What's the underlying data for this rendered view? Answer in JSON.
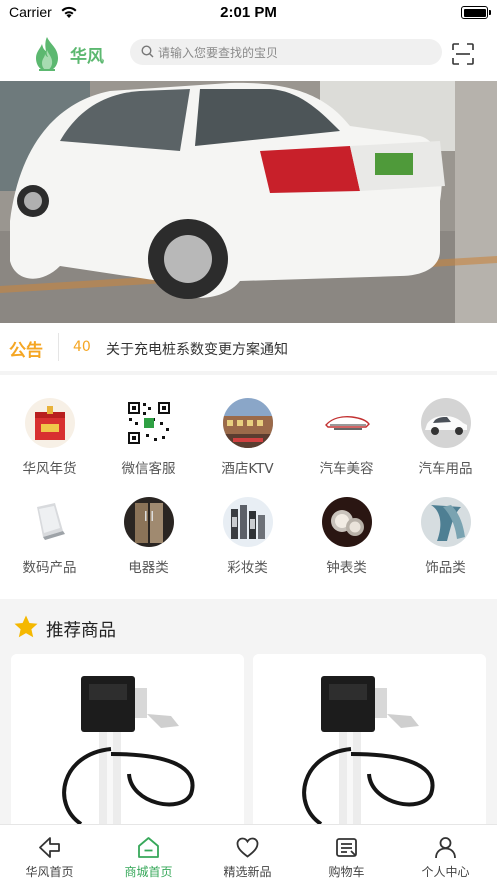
{
  "status_bar": {
    "carrier": "Carrier",
    "time": "2:01 PM"
  },
  "header": {
    "brand": "华风",
    "search_placeholder": "请输入您要查找的宝贝"
  },
  "notice": {
    "tag": "公告",
    "count": "40",
    "text": "关于充电桩系数变更方案通知"
  },
  "categories": [
    {
      "label": "华风年货",
      "icon": "gift-box-icon"
    },
    {
      "label": "微信客服",
      "icon": "qr-code-icon"
    },
    {
      "label": "酒店KTV",
      "icon": "hotel-icon"
    },
    {
      "label": "汽车美容",
      "icon": "car-logo-icon"
    },
    {
      "label": "汽车用品",
      "icon": "car-icon"
    },
    {
      "label": "数码产品",
      "icon": "laptop-icon"
    },
    {
      "label": "电器类",
      "icon": "fridge-icon"
    },
    {
      "label": "彩妆类",
      "icon": "cosmetics-icon"
    },
    {
      "label": "钟表类",
      "icon": "watch-icon"
    },
    {
      "label": "饰品类",
      "icon": "scarf-icon"
    }
  ],
  "recommend": {
    "title": "推荐商品"
  },
  "tabs": [
    {
      "label": "华风首页",
      "icon": "back-arrow-icon"
    },
    {
      "label": "商城首页",
      "icon": "home-icon",
      "active": true
    },
    {
      "label": "精选新品",
      "icon": "heart-icon"
    },
    {
      "label": "购物车",
      "icon": "cart-icon"
    },
    {
      "label": "个人中心",
      "icon": "user-icon"
    }
  ],
  "colors": {
    "brand_green": "#5cb870",
    "active_tab": "#37a85a",
    "notice_orange": "#f5a623",
    "star": "#f5b800"
  }
}
